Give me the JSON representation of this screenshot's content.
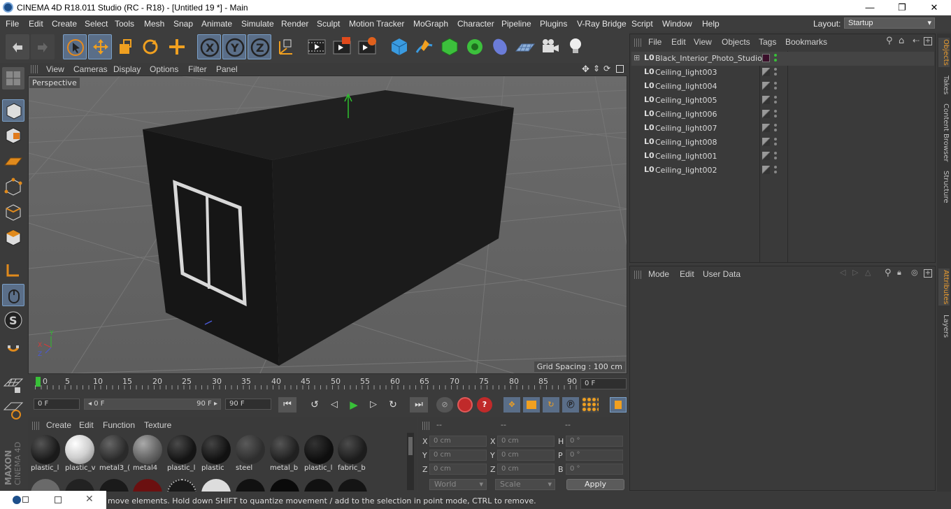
{
  "window": {
    "title": "CINEMA 4D R18.011 Studio (RC - R18) - [Untitled 19 *] - Main",
    "min": "—",
    "max": "❐",
    "close": "✕"
  },
  "menubar": {
    "items": [
      "File",
      "Edit",
      "Create",
      "Select",
      "Tools",
      "Mesh",
      "Snap",
      "Animate",
      "Simulate",
      "Render",
      "Sculpt",
      "Motion Tracker",
      "MoGraph",
      "Character",
      "Pipeline",
      "Plugins",
      "V-Ray Bridge",
      "Script",
      "Window",
      "Help"
    ],
    "layout_label": "Layout:",
    "layout_value": "Startup"
  },
  "toolbar": {
    "buttons": [
      "undo-icon",
      "redo-icon",
      "live-selection-icon",
      "move-icon",
      "scale-icon",
      "rotate-icon",
      "add-icon",
      "x-axis-icon",
      "y-axis-icon",
      "z-axis-icon",
      "coordinate-system-icon",
      "render-view-icon",
      "render-picture-viewer-icon",
      "render-settings-icon",
      "cube-icon",
      "pen-icon",
      "subdivision-icon",
      "cloner-icon",
      "deformer-icon",
      "floor-icon",
      "camera-icon",
      "light-icon"
    ]
  },
  "viewport": {
    "menu": [
      "View",
      "Cameras",
      "Display",
      "Options",
      "Filter",
      "Panel"
    ],
    "label": "Perspective",
    "grid_spacing": "Grid Spacing : 100 cm"
  },
  "timeline": {
    "ticks": [
      "0",
      "5",
      "10",
      "15",
      "20",
      "25",
      "30",
      "35",
      "40",
      "45",
      "50",
      "55",
      "60",
      "65",
      "70",
      "75",
      "80",
      "85",
      "90"
    ],
    "current_frame": "0 F",
    "start": "0 F",
    "slider_left": "◂ 0 F",
    "slider_right": "90 F ▸",
    "end": "90 F"
  },
  "materials": {
    "menu": [
      "Create",
      "Edit",
      "Function",
      "Texture"
    ],
    "items": [
      {
        "name": "plastic_l",
        "color": "#1a1a1a"
      },
      {
        "name": "plastic_v",
        "color": "#e8e8e8"
      },
      {
        "name": "metal3_(",
        "color": "#2a2a2a"
      },
      {
        "name": "metal4",
        "color": "#6a6a6a"
      },
      {
        "name": "plastic_l",
        "color": "#141414"
      },
      {
        "name": "plastic",
        "color": "#111111"
      },
      {
        "name": "steel",
        "color": "#2e2e2e"
      },
      {
        "name": "metal_b",
        "color": "#202020"
      },
      {
        "name": "plastic_l",
        "color": "#0e0e0e"
      },
      {
        "name": "fabric_b",
        "color": "#1c1c1c"
      }
    ]
  },
  "coords": {
    "headers": [
      "--",
      "--",
      "--"
    ],
    "rows": [
      {
        "a": "X",
        "av": "0 cm",
        "b": "X",
        "bv": "0 cm",
        "c": "H",
        "cv": "0 °"
      },
      {
        "a": "Y",
        "av": "0 cm",
        "b": "Y",
        "bv": "0 cm",
        "c": "P",
        "cv": "0 °"
      },
      {
        "a": "Z",
        "av": "0 cm",
        "b": "Z",
        "bv": "0 cm",
        "c": "B",
        "cv": "0 °"
      }
    ],
    "world": "World",
    "scale": "Scale",
    "apply": "Apply"
  },
  "objects": {
    "menu": [
      "File",
      "Edit",
      "View",
      "Objects",
      "Tags",
      "Bookmarks"
    ],
    "items": [
      "Black_Interior_Photo_Studio",
      "Ceiling_light003",
      "Ceiling_light004",
      "Ceiling_light005",
      "Ceiling_light006",
      "Ceiling_light007",
      "Ceiling_light008",
      "Ceiling_light001",
      "Ceiling_light002"
    ]
  },
  "attributes": {
    "menu": [
      "Mode",
      "Edit",
      "User Data"
    ]
  },
  "right_tabs": {
    "top": [
      "Objects",
      "Takes",
      "Content Browser",
      "Structure"
    ],
    "bottom": [
      "Attributes",
      "Layers"
    ]
  },
  "status": {
    "text": "move elements. Hold down SHIFT to quantize movement / add to the selection in point mode, CTRL to remove."
  },
  "brand": {
    "line1": "MAXON",
    "line2": "CINEMA 4D"
  },
  "colors": {
    "accent": "#5a9ad8",
    "active_tab": "#e89b2f"
  }
}
